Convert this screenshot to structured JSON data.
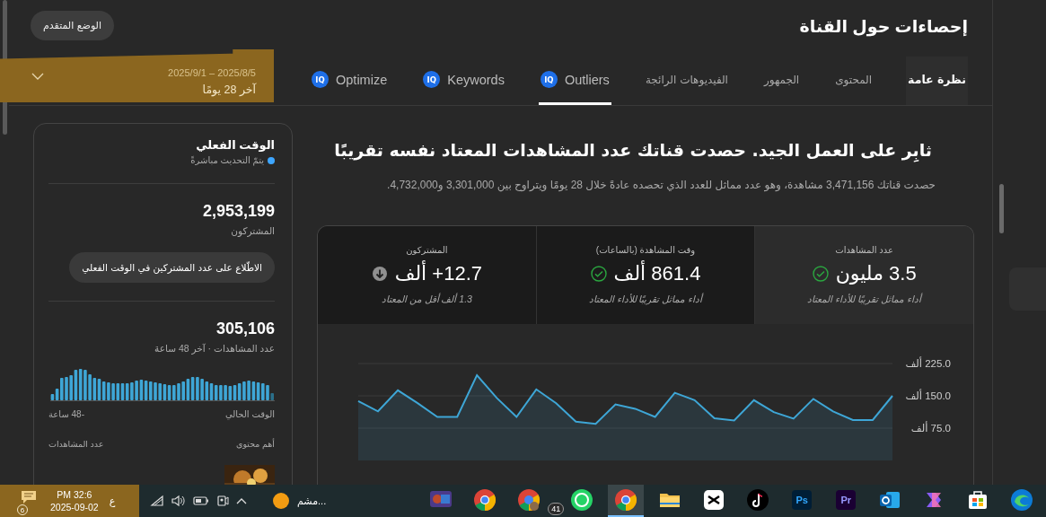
{
  "header": {
    "title": "إحصاءات حول القناة",
    "advanced_button": "الوضع المتقدم"
  },
  "tabs": [
    {
      "label": "نظرة عامة",
      "kind": "text",
      "selected": true,
      "underlined": false
    },
    {
      "label": "المحتوى",
      "kind": "text",
      "selected": false,
      "underlined": false
    },
    {
      "label": "الجمهور",
      "kind": "text",
      "selected": false,
      "underlined": false
    },
    {
      "label": "الفيديوهات الرائجة",
      "kind": "text",
      "selected": false,
      "underlined": false
    },
    {
      "label": "Outliers",
      "kind": "extension",
      "badge": "IQ",
      "selected": false,
      "underlined": true
    },
    {
      "label": "Keywords",
      "kind": "extension",
      "badge": "IQ",
      "selected": false,
      "underlined": false
    },
    {
      "label": "Optimize",
      "kind": "extension",
      "badge": "IQ",
      "selected": false,
      "underlined": false
    }
  ],
  "date_range": {
    "range": "2025/8/5 – 2025/9/1",
    "period": "آخر 28 يومًا"
  },
  "realtime": {
    "title": "الوقت الفعلي",
    "live_status": "يتمّ التحديث مباشرةً",
    "subscribers": "2,953,199",
    "subscribers_label": "المشتركون",
    "button": "الاطّلاع على عدد المشتركين في الوقت الفعلي",
    "views": "305,106",
    "views_label": "عدد المشاهدات · آخر 48 ساعة",
    "axis_end": "الوقت الحالي",
    "axis_start": "-48 ساعة",
    "top_content_label": "أهم محتوى",
    "views_column_label": "عدد المشاهدات"
  },
  "summary": {
    "headline": "ثابِر على العمل الجيد. حصدت قناتك عدد المشاهدات المعتاد نفسه تقريبًا",
    "description": "حصدت قناتك 3,471,156 مشاهدة، وهو عدد مماثل للعدد الذي تحصده عادةً خلال 28 يومًا ويتراوح بين 3,301,000 و4,732,000."
  },
  "metrics": [
    {
      "label": "عدد المشاهدات",
      "value": "3.5 مليون",
      "kind": "typical",
      "note": "أداء مماثل تقريبًا للأداء المعتاد",
      "selected": true
    },
    {
      "label": "وقت المشاهدة (بالساعات)",
      "value": "861.4 ألف",
      "kind": "typical",
      "note": "أداء مماثل تقريبًا للأداء المعتاد",
      "selected": false
    },
    {
      "label": "المشتركون",
      "value": "12.7+ ألف",
      "kind": "below",
      "note": "1.3 ألف أقل من المعتاد",
      "selected": false
    }
  ],
  "chart": {
    "chart_data": {
      "type": "area",
      "grid": true,
      "ylim": [
        0,
        225
      ],
      "series": [
        {
          "color": "#3ea6d6",
          "values": [
            138,
            114,
            163,
            133,
            101,
            101,
            198,
            145,
            101,
            165,
            133,
            90,
            85,
            130,
            120,
            101,
            157,
            140,
            98,
            93,
            140,
            112,
            97,
            143,
            114,
            94,
            94,
            150
          ]
        }
      ],
      "yticks": [
        {
          "value": 75,
          "label": "75.0 ألف"
        },
        {
          "value": 150,
          "label": "150.0 ألف"
        },
        {
          "value": 225,
          "label": "225.0 ألف"
        }
      ]
    }
  },
  "taskbar": {
    "notifications": "6",
    "time": "PM 32:6",
    "date": "2025-09-02",
    "language": "ع",
    "weather_text": "مشم...",
    "apps": [
      {
        "kind": "edge",
        "active": false
      },
      {
        "kind": "store",
        "active": false
      },
      {
        "kind": "copilot",
        "active": false
      },
      {
        "kind": "outlook",
        "active": false
      },
      {
        "kind": "pr",
        "label": "Pr",
        "active": false
      },
      {
        "kind": "ps",
        "label": "Ps",
        "active": false
      },
      {
        "kind": "tiktok",
        "active": false
      },
      {
        "kind": "capcut",
        "active": false
      },
      {
        "kind": "folder",
        "active": false
      },
      {
        "kind": "chrome",
        "active": true
      },
      {
        "kind": "whatsapp",
        "badge": "41",
        "active": false
      },
      {
        "kind": "chrome-profile",
        "active": false
      },
      {
        "kind": "chrome",
        "active": false
      },
      {
        "kind": "game",
        "active": false
      }
    ]
  }
}
